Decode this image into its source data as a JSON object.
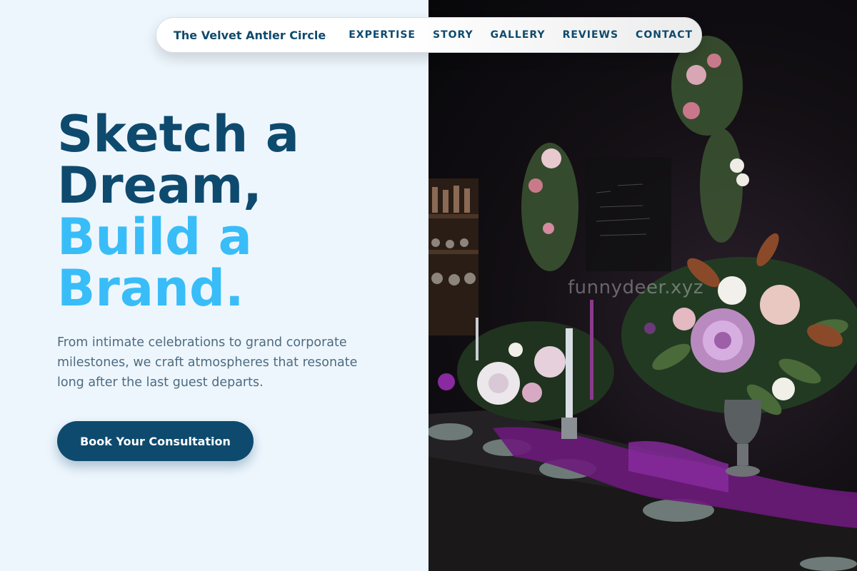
{
  "nav": {
    "brand": "The Velvet Antler Circle",
    "links": [
      "EXPERTISE",
      "STORY",
      "GALLERY",
      "REVIEWS",
      "CONTACT"
    ]
  },
  "hero": {
    "line1": "Sketch a",
    "line2": "Dream,",
    "line3": "Build a",
    "line4": "Brand.",
    "subtitle": "From intimate celebrations to grand corporate milestones, we craft atmospheres that resonate long after the last guest departs.",
    "cta": "Book Your Consultation"
  },
  "photo": {
    "watermark": "funnydeer.xyz"
  },
  "colors": {
    "primary": "#0e4a6e",
    "accent": "#38bdf8",
    "background": "#eef6fd"
  }
}
